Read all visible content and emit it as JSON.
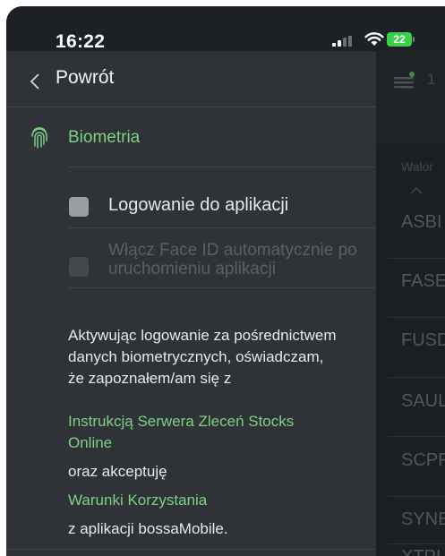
{
  "status_bar": {
    "time": "16:22",
    "battery": "22"
  },
  "drawer": {
    "back_label": "Powrót",
    "section_label": "Biometria",
    "login_label": "Logowanie do aplikacji",
    "faceid_label": "Włącz Face ID automatycznie po uruchomieniu aplikacji",
    "login_checked": false,
    "faceid_checked": false,
    "faceid_enabled": false,
    "consent_text": "Aktywując logowanie za pośrednictwem danych biometrycznych, oświadczam, że zapoznałem/am się z",
    "instruction_link": "Instrukcją Serwera Zleceń Stocks Online",
    "and_accept": "oraz akceptuję",
    "terms_link": "Warunki Korzystania",
    "app_text": "z aplikacji bossaMobile."
  },
  "background": {
    "header_text": "1",
    "column_header": "Walor",
    "tickers": [
      "ASBI",
      "FASE",
      "FUSD",
      "SAUL",
      "SCPF",
      "SYNE",
      "XTPI"
    ]
  },
  "icons": {
    "back": "chevron-left-icon",
    "section": "fingerprint-icon",
    "signal": "signal-icon",
    "wifi": "wifi-icon",
    "battery": "battery-icon",
    "menu": "menu-filter-icon",
    "sort": "chevron-up-icon"
  },
  "colors": {
    "accent": "#7fd085",
    "drawer_bg": "#2f3337",
    "status_bar_bg": "#1d2024",
    "background_bg": "#1c1f22"
  }
}
